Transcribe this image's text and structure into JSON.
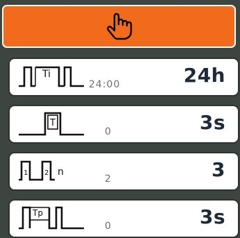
{
  "header": {
    "icon": "hand-pointer-icon"
  },
  "rows": [
    {
      "icon": "two-pulse-interval-icon",
      "icon_label": "Ti",
      "sub_value": "24:00",
      "value": "24h"
    },
    {
      "icon": "single-pulse-icon",
      "icon_label": "T",
      "sub_value": "0",
      "value": "3s"
    },
    {
      "icon": "numbered-pulses-icon",
      "icon_label_1": "1",
      "icon_label_2": "2",
      "icon_label_n": "n",
      "sub_value": "2",
      "value": "3"
    },
    {
      "icon": "pulse-pause-icon",
      "icon_label": "Tp",
      "sub_value": "0",
      "value": "3s"
    }
  ]
}
